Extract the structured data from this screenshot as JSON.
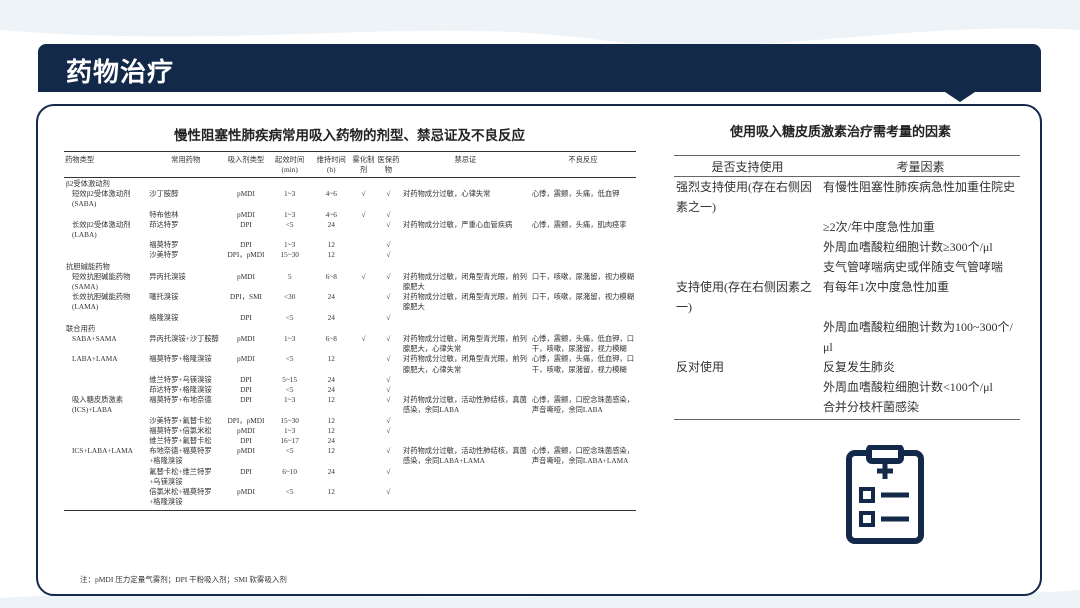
{
  "header": {
    "title": "药物治疗"
  },
  "left": {
    "title": "慢性阻塞性肺疾病常用吸入药物的剂型、禁忌证及不良反应",
    "columns": [
      "药物类型",
      "常用药物",
      "吸入剂类型",
      "起效时间(min)",
      "维持时间(h)",
      "雾化制剂",
      "医保药物",
      "禁忌证",
      "不良反应"
    ],
    "rows": [
      {
        "type": "β2受体激动剂"
      },
      {
        "type": "短效β2受体激动剂(SABA)",
        "drug": "沙丁胺醇",
        "form": "pMDI",
        "onset": "1~3",
        "dur": "4~6",
        "neb": "√",
        "ins": "√",
        "contra": "对药物成分过敏，心律失常",
        "adverse": "心悸，震颤，头痛，低血钾"
      },
      {
        "drug": "特布他林",
        "form": "pMDI",
        "onset": "1~3",
        "dur": "4~6",
        "neb": "√",
        "ins": "√"
      },
      {
        "type": "长效β2受体激动剂(LABA)",
        "drug": "茚达特罗",
        "form": "DPI",
        "onset": "<5",
        "dur": "24",
        "ins": "√",
        "contra": "对药物成分过敏，严重心血管疾病",
        "adverse": "心悸，震颤，头痛，肌肉痉挛"
      },
      {
        "drug": "福莫特罗",
        "form": "DPI",
        "onset": "1~3",
        "dur": "12",
        "ins": "√"
      },
      {
        "drug": "沙美特罗",
        "form": "DPI，pMDI",
        "onset": "15~30",
        "dur": "12",
        "ins": "√"
      },
      {
        "type": "抗胆碱能药物"
      },
      {
        "type": "短效抗胆碱能药物(SAMA)",
        "drug": "异丙托溴铵",
        "form": "pMDI",
        "onset": "5",
        "dur": "6~8",
        "neb": "√",
        "ins": "√",
        "contra": "对药物成分过敏，闭角型青光眼，前列腺肥大",
        "adverse": "口干，咳嗽，尿潴留，视力模糊"
      },
      {
        "type": "长效抗胆碱能药物(LAMA)",
        "drug": "噻托溴铵",
        "form": "DPI，SMI",
        "onset": "<30",
        "dur": "24",
        "ins": "√",
        "contra": "对药物成分过敏，闭角型青光眼，前列腺肥大",
        "adverse": "口干，咳嗽，尿潴留，视力模糊"
      },
      {
        "drug": "格隆溴铵",
        "form": "DPI",
        "onset": "<5",
        "dur": "24",
        "ins": "√"
      },
      {
        "type": "联合用药"
      },
      {
        "type": "SABA+SAMA",
        "drug": "异丙托溴铵+沙丁胺醇",
        "form": "pMDI",
        "onset": "1~3",
        "dur": "6~8",
        "neb": "√",
        "ins": "√",
        "contra": "对药物成分过敏，闭角型青光眼，前列腺肥大，心律失常",
        "adverse": "心悸，震颤，头痛，低血钾，口干，咳嗽，尿潴留，视力模糊"
      },
      {
        "type": "LABA+LAMA",
        "drug": "福莫特罗+格隆溴铵",
        "form": "pMDI",
        "onset": "<5",
        "dur": "12",
        "ins": "√",
        "contra": "对药物成分过敏，闭角型青光眼，前列腺肥大，心律失常",
        "adverse": "心悸，震颤，头痛，低血钾，口干，咳嗽，尿潴留，视力模糊"
      },
      {
        "drug": "维兰特罗+乌镁溴铵",
        "form": "DPI",
        "onset": "5~15",
        "dur": "24",
        "ins": "√"
      },
      {
        "drug": "茚达特罗+格隆溴铵",
        "form": "DPI",
        "onset": "<5",
        "dur": "24",
        "ins": "√"
      },
      {
        "type": "吸入糖皮质激素(ICS)+LABA",
        "drug": "福莫特罗+布地奈德",
        "form": "DPI",
        "onset": "1~3",
        "dur": "12",
        "ins": "√",
        "contra": "对药物成分过敏，活动性肺结核，真菌感染，余同LABA",
        "adverse": "心悸，震颤，口腔念珠菌感染，声音嘶哑，余同LABA"
      },
      {
        "drug": "沙美特罗+氟替卡松",
        "form": "DPI，pMDI",
        "onset": "15~30",
        "dur": "12",
        "ins": "√"
      },
      {
        "drug": "福莫特罗+倍氯米松",
        "form": "pMDI",
        "onset": "1~3",
        "dur": "12",
        "ins": "√"
      },
      {
        "drug": "维兰特罗+氟替卡松",
        "form": "DPI",
        "onset": "16~17",
        "dur": "24"
      },
      {
        "type": "ICS+LABA+LAMA",
        "drug": "布地奈德+福莫特罗+格隆溴铵",
        "form": "pMDI",
        "onset": "<5",
        "dur": "12",
        "ins": "√",
        "contra": "对药物成分过敏，活动性肺结核，真菌感染，余同LABA+LAMA",
        "adverse": "心悸，震颤，口腔念珠菌感染，声音嘶哑，余同LABA+LAMA"
      },
      {
        "drug": "氟替卡松+维兰特罗+乌镁溴铵",
        "form": "DPI",
        "onset": "6~10",
        "dur": "24",
        "ins": "√"
      },
      {
        "drug": "倍氯米松+福莫特罗+格隆溴铵",
        "form": "pMDI",
        "onset": "<5",
        "dur": "12",
        "ins": "√"
      }
    ],
    "note": "注：pMDI 压力定量气雾剂；DPI 干粉吸入剂；SMI 软雾吸入剂"
  },
  "right": {
    "title": "使用吸入糖皮质激素治疗需考量的因素",
    "columns": [
      "是否支持使用",
      "考量因素"
    ],
    "rows": [
      {
        "support": "强烈支持使用(存在右侧因素之一)",
        "factor": "有慢性阻塞性肺疾病急性加重住院史"
      },
      {
        "factor": "≥2次/年中度急性加重"
      },
      {
        "factor": "外周血嗜酸粒细胞计数≥300个/μl"
      },
      {
        "factor": "支气管哮喘病史或伴随支气管哮喘"
      },
      {
        "support": "支持使用(存在右侧因素之一)",
        "factor": "有每年1次中度急性加重"
      },
      {
        "factor": "外周血嗜酸粒细胞计数为100~300个/μl"
      },
      {
        "support": "反对使用",
        "factor": "反复发生肺炎"
      },
      {
        "factor": "外周血嗜酸粒细胞计数<100个/μl"
      },
      {
        "factor": "合并分枝杆菌感染"
      }
    ]
  },
  "colors": {
    "navy": "#13294a",
    "accent_light": "#e6eef6"
  },
  "icons": {
    "decor": "clipboard-checklist-icon"
  }
}
